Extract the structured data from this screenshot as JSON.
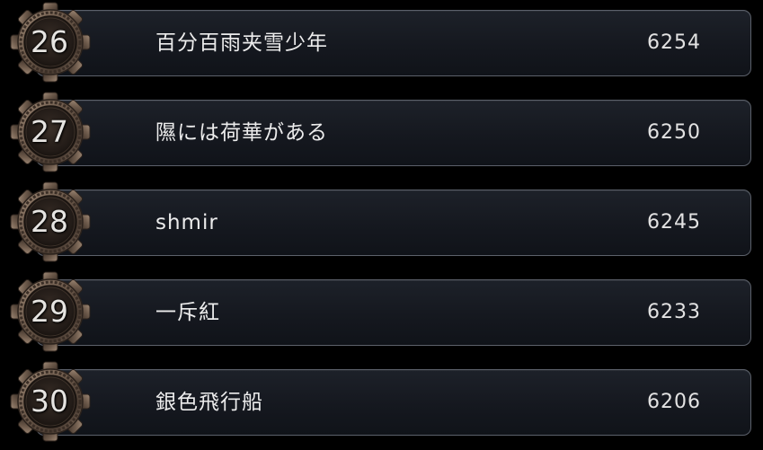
{
  "leaderboard": {
    "rows": [
      {
        "rank": "26",
        "name": "百分百雨夹雪少年",
        "score": "6254"
      },
      {
        "rank": "27",
        "name": "隰には荷華がある",
        "score": "6250"
      },
      {
        "rank": "28",
        "name": "shmir",
        "score": "6245"
      },
      {
        "rank": "29",
        "name": "一斥紅",
        "score": "6233"
      },
      {
        "rank": "30",
        "name": "銀色飛行船",
        "score": "6206"
      }
    ]
  },
  "colors": {
    "background": "#000000",
    "panel": "#171a21",
    "panel_border": "#5c616b",
    "badge_metal": "#6b5a4c",
    "badge_inner": "#2a221d",
    "text": "#ececec"
  },
  "icons": {
    "rank_badge": "ornate-gear-medallion-icon"
  }
}
